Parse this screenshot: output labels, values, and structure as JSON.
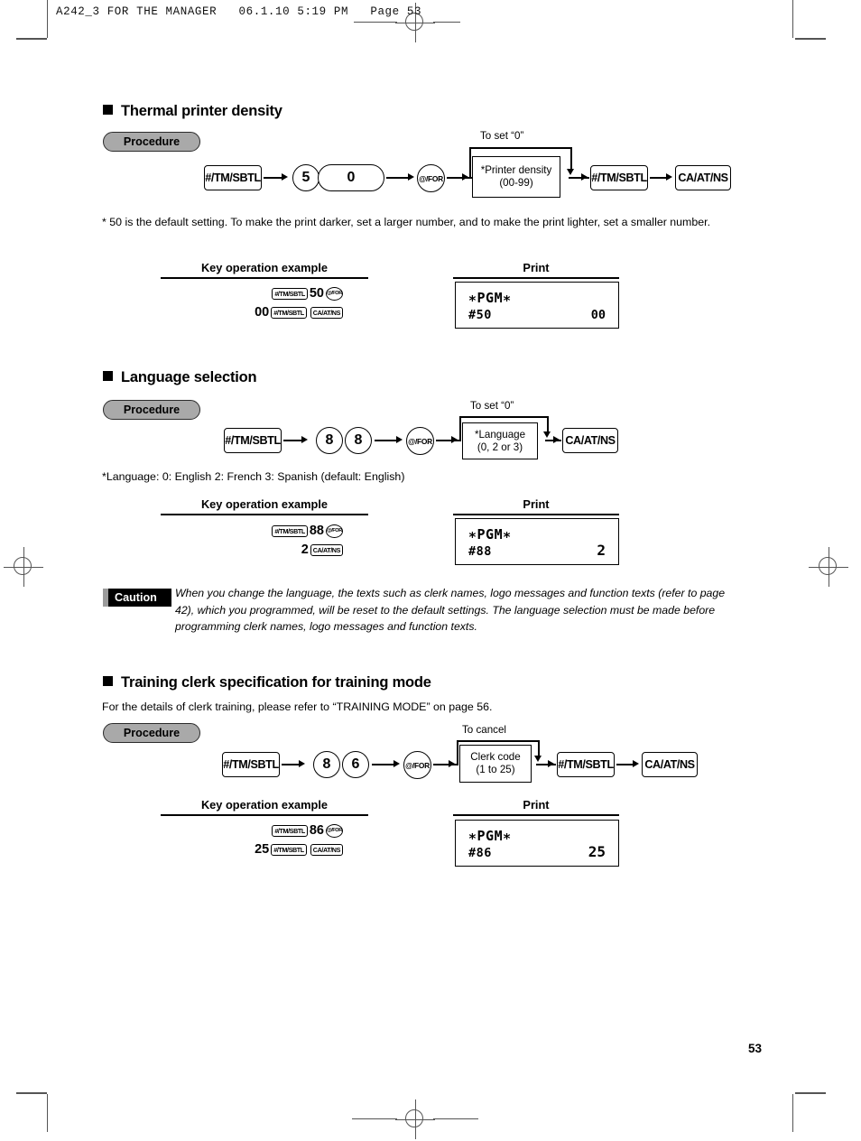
{
  "page": {
    "file_header": "A242_3 FOR THE MANAGER   06.1.10 5:19 PM   Page 53",
    "page_number": "53"
  },
  "labels": {
    "procedure": "Procedure",
    "key_operation_example": "Key operation example",
    "print": "Print"
  },
  "sections": [
    {
      "title": "Thermal printer density",
      "flow": {
        "branch_label": "To set “0”",
        "start_key": "#/TM/SBTL",
        "digits": [
          "5",
          "0"
        ],
        "for_key": "@/FOR",
        "box_line1": "*Printer density",
        "box_line2": "(00-99)",
        "end_keys": [
          "#/TM/SBTL",
          "CA/AT/NS"
        ]
      },
      "note": "* 50 is the default setting.  To make the print darker, set a larger number, and to make the print lighter, set a smaller number.",
      "example": {
        "line1_keys": [
          "#/TM/SBTL"
        ],
        "line1_value": "50",
        "line1_tail_key": "@/FOR",
        "line2_value": "00",
        "line2_keys": [
          "#/TM/SBTL",
          "CA/AT/NS"
        ]
      },
      "receipt": {
        "title": "∗PGM∗",
        "code": "#50",
        "value": "00"
      }
    },
    {
      "title": "Language selection",
      "flow": {
        "branch_label": "To set “0”",
        "start_key": "#/TM/SBTL",
        "digits": [
          "8",
          "8"
        ],
        "for_key": "@/FOR",
        "box_line1": "*Language",
        "box_line2": "(0, 2 or 3)",
        "end_keys": [
          "CA/AT/NS"
        ]
      },
      "note": "*Language: 0: English       2: French       3: Spanish  (default: English)",
      "example": {
        "line1_keys": [
          "#/TM/SBTL"
        ],
        "line1_value": "88",
        "line1_tail_key": "@/FOR",
        "line2_value": "2",
        "line2_keys": [
          "CA/AT/NS"
        ]
      },
      "receipt": {
        "title": "∗PGM∗",
        "code": "#88",
        "value": "2"
      }
    },
    {
      "title": "Training clerk specification for training mode",
      "intro": "For the details of clerk training, please refer to “TRAINING MODE” on page 56.",
      "flow": {
        "branch_label": "To cancel",
        "start_key": "#/TM/SBTL",
        "digits": [
          "8",
          "6"
        ],
        "for_key": "@/FOR",
        "box_line1": "Clerk code",
        "box_line2": "(1 to 25)",
        "end_keys": [
          "#/TM/SBTL",
          "CA/AT/NS"
        ]
      },
      "example": {
        "line1_keys": [
          "#/TM/SBTL"
        ],
        "line1_value": "86",
        "line1_tail_key": "@/FOR",
        "line2_value": "25",
        "line2_keys": [
          "#/TM/SBTL",
          "CA/AT/NS"
        ]
      },
      "receipt": {
        "title": "∗PGM∗",
        "code": "#86",
        "value": "25"
      }
    }
  ],
  "caution": {
    "label": "Caution",
    "text": "When you change the language, the texts such as clerk names, logo messages and function texts (refer to page 42), which you programmed, will be reset to the default settings.  The language selection must be made before programming clerk names, logo messages and function texts."
  }
}
